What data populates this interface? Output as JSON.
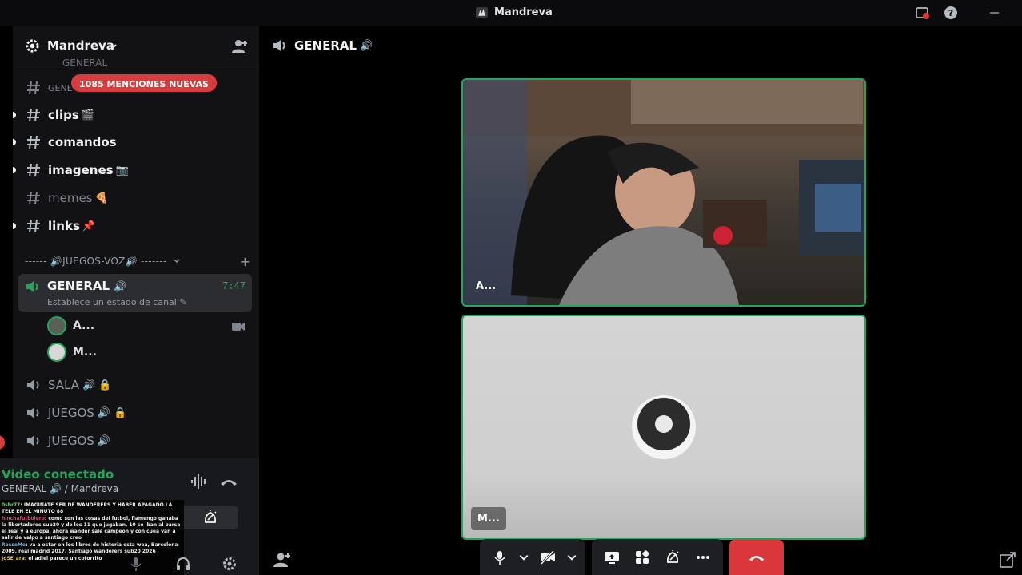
{
  "window": {
    "title": "Mandreva"
  },
  "server": {
    "name": "Mandreva"
  },
  "sidebar": {
    "cut_channel": "GENERAL",
    "mention_pill": "1085 MENCIONES NUEVAS",
    "partial_channel": "GENE",
    "text_channels": [
      {
        "name": "clips",
        "emoji": "🎬",
        "unread": true
      },
      {
        "name": "comandos",
        "emoji": "",
        "unread": true
      },
      {
        "name": "imagenes",
        "emoji": "📷",
        "unread": true
      },
      {
        "name": "memes",
        "emoji": "🍕",
        "unread": false
      },
      {
        "name": "links",
        "emoji": "📌",
        "unread": true
      }
    ],
    "category": "------ 🔊JUEGOS-VOZ🔊 -------",
    "active_voice": {
      "name": "GENERAL",
      "emoji": "🔊",
      "time": "7:47",
      "status": "Establece un estado de canal"
    },
    "voice_users": [
      {
        "name": "A..."
      },
      {
        "name": "M..."
      }
    ],
    "voice_channels": [
      {
        "name": "SALA",
        "emoji": "🔊",
        "locked": true
      },
      {
        "name": "JUEGOS",
        "emoji": "🔊",
        "locked": true
      },
      {
        "name": "JUEGOS",
        "emoji": "🔊",
        "locked": false
      }
    ]
  },
  "voice_panel": {
    "title": "Video conectado",
    "subtitle": "GENERAL 🔊 / Mandreva"
  },
  "chat_overlay": [
    {
      "user": "0sbr77",
      "text": ": IMAGÍNATE SER DE WANDERERS Y HABER APAGADO LA TELE EN EL MINUTO 88"
    },
    {
      "user": "hinchafutbolero",
      "text": ": como son las cosas del futbol, flamengo ganaba la libertadores sub20 y de los 11 que jugaban, 10 se iban al barsa el real y a europa, ahora wander sale campeon y con cuea van a salir de valpo a santiago creo"
    },
    {
      "user": "RosseMe",
      "text": ": va a estar en los libros de historia esta wea, Barcelona 2009, real madrid 2017, Santiago wanderers sub20 2026"
    },
    {
      "user": "JoSE_ara",
      "text": ": el adiel parece un cotorrito"
    }
  ],
  "main": {
    "channel_title": "GENERAL",
    "channel_emoji": "🔊",
    "tiles": [
      {
        "name": "A..."
      },
      {
        "name": "M..."
      }
    ]
  },
  "colors": {
    "accent_green": "#23a55a",
    "danger_red": "#da373c",
    "mention_red": "#d83c3e"
  }
}
